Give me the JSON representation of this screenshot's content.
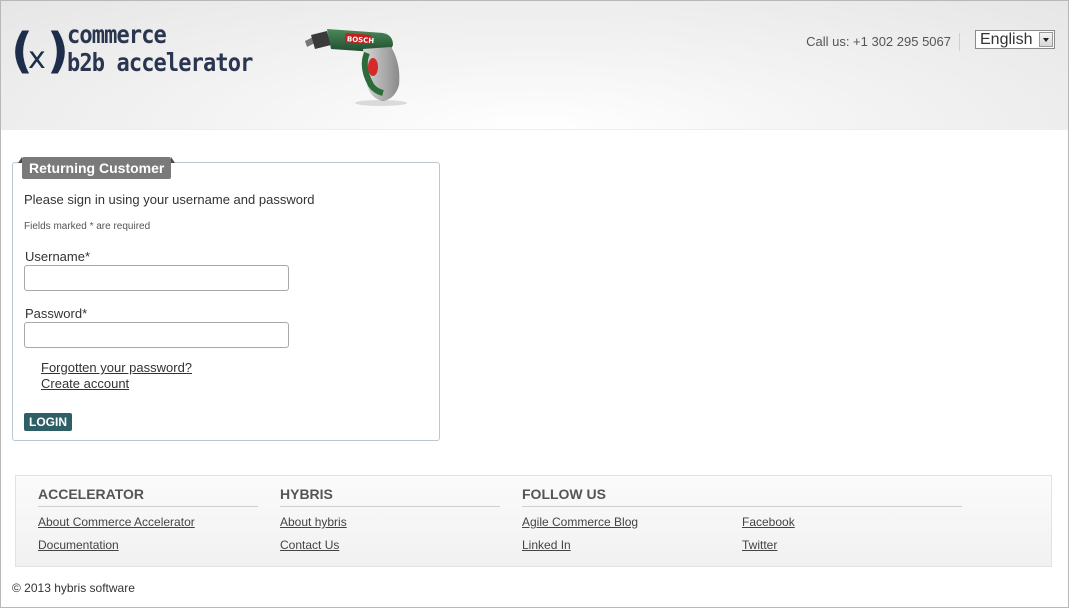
{
  "header": {
    "logo_line1": "commerce",
    "logo_line2": "b2b accelerator",
    "logo_mark_left": "(",
    "logo_mark_mid": "x",
    "logo_mark_right": ")",
    "product_image": "cordless-screwdriver-image",
    "product_brand": "BOSCH",
    "call_us": "Call us: +1 302 295 5067",
    "language": {
      "selected": "English",
      "icon": "chevron-down-icon"
    }
  },
  "login": {
    "title": "Returning Customer",
    "intro": "Please sign in using your username and password",
    "required_note": "Fields marked * are required",
    "username_label": "Username*",
    "username_value": "",
    "password_label": "Password*",
    "password_value": "",
    "forgot_link": "Forgotten your password?",
    "create_link": "Create account",
    "button": "LOGIN",
    "button_color": "#2f5f66"
  },
  "footer": {
    "columns": [
      {
        "heading": "ACCELERATOR",
        "links": [
          "About Commerce Accelerator",
          "Documentation"
        ]
      },
      {
        "heading": "HYBRIS",
        "links": [
          "About hybris",
          "Contact Us"
        ]
      },
      {
        "heading": "FOLLOW US",
        "links": [
          "Agile Commerce Blog",
          "Linked In",
          "Facebook",
          "Twitter"
        ]
      }
    ]
  },
  "copyright": "© 2013 hybris software"
}
